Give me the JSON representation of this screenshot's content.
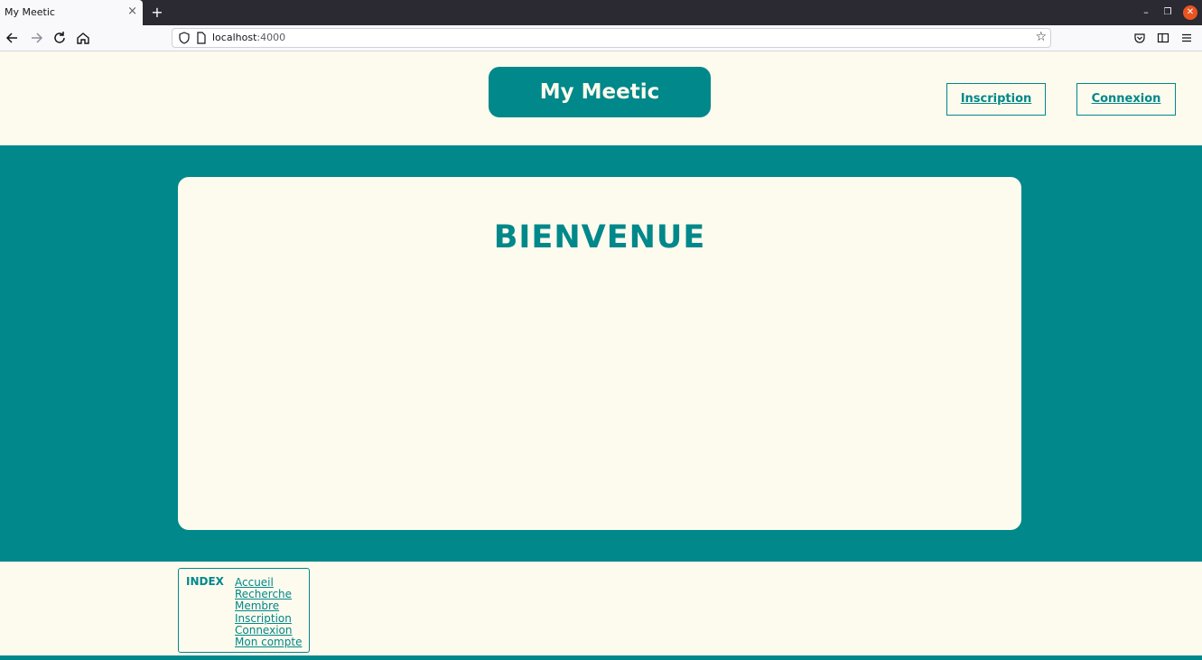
{
  "browser": {
    "tab_title": "My Meetic",
    "tab_close": "×",
    "new_tab": "+",
    "url_host": "localhost",
    "url_port": ":4000"
  },
  "header": {
    "logo": "My Meetic",
    "inscription": "Inscription",
    "connexion": "Connexion"
  },
  "main": {
    "welcome": "BIENVENUE"
  },
  "index": {
    "title": "INDEX",
    "links": [
      "Accueil",
      "Recherche",
      "Membre",
      "Inscription",
      "Connexion",
      "Mon compte"
    ]
  },
  "colors": {
    "accent": "#00888a",
    "background": "#fdfaee",
    "chrome_dark": "#2b2a33",
    "close_button": "#e95420"
  }
}
